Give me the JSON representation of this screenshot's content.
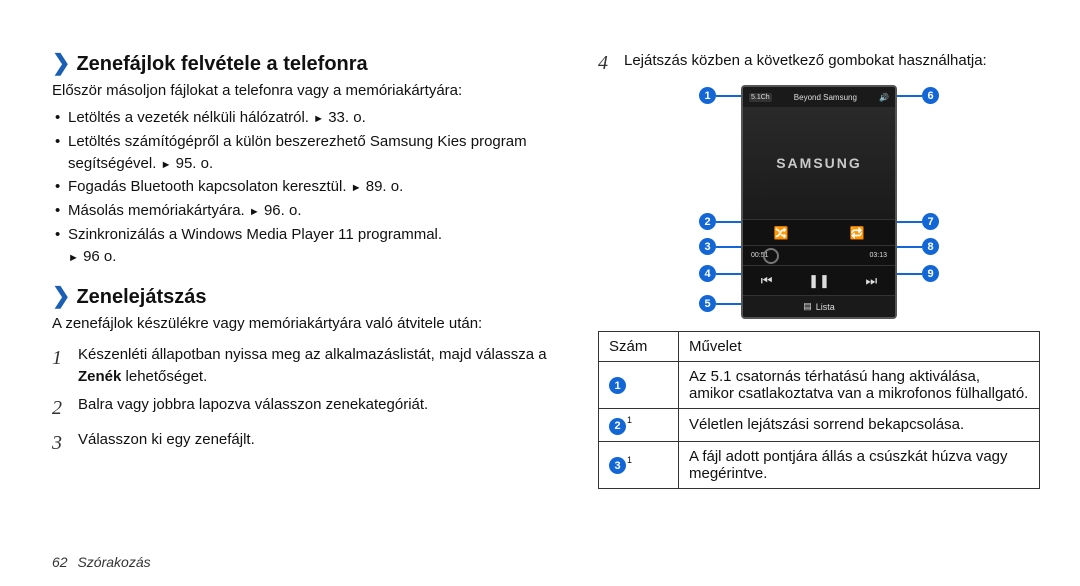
{
  "leftCol": {
    "heading1": "Zenefájlok felvétele a telefonra",
    "intro1": "Először másoljon fájlokat a telefonra vagy a memóriakártyára:",
    "bullets": [
      {
        "text": "Letöltés a vezeték nélküli hálózatról.",
        "ref": "33. o."
      },
      {
        "text": "Letöltés számítógépről a külön beszerezhető Samsung Kies program segítségével.",
        "ref": "95. o."
      },
      {
        "text": "Fogadás Bluetooth kapcsolaton keresztül.",
        "ref": "89. o."
      },
      {
        "text": "Másolás memóriakártyára.",
        "ref": "96. o."
      },
      {
        "text": "Szinkronizálás a Windows Media Player 11 programmal.",
        "ref": "96 o."
      }
    ],
    "heading2": "Zenelejátszás",
    "intro2": "A zenefájlok készülékre vagy memóriakártyára való átvitele után:",
    "steps": [
      {
        "n": "1",
        "pre": "Készenléti állapotban nyissa meg az alkalmazáslistát, majd válassza a ",
        "bold": "Zenék",
        "post": " lehetőséget."
      },
      {
        "n": "2",
        "pre": "Balra vagy jobbra lapozva válasszon zenekategóriát.",
        "bold": "",
        "post": ""
      },
      {
        "n": "3",
        "pre": "Válasszon ki egy zenefájlt.",
        "bold": "",
        "post": ""
      }
    ]
  },
  "rightCol": {
    "stepNum": "4",
    "stepText": "Lejátszás közben a következő gombokat használhatja:",
    "phone": {
      "chip": "5.1Ch",
      "title": "Beyond Samsung",
      "brand": "SAMSUNG",
      "t0": "00:51",
      "t1": "03:13",
      "lista": "Lista"
    },
    "callouts": {
      "left": [
        "1",
        "2",
        "3",
        "4",
        "5"
      ],
      "right": [
        "6",
        "7",
        "8",
        "9"
      ]
    },
    "table": {
      "h1": "Szám",
      "h2": "Művelet",
      "rows": [
        {
          "num": "1",
          "sup": "",
          "desc": "Az 5.1 csatornás térhatású hang aktiválása, amikor csatlakoztatva van a mikrofonos fülhallgató."
        },
        {
          "num": "2",
          "sup": "1",
          "desc": "Véletlen lejátszási sorrend bekapcsolása."
        },
        {
          "num": "3",
          "sup": "1",
          "desc": "A fájl adott pontjára állás a csúszkát húzva vagy megérintve."
        }
      ]
    }
  },
  "footer": {
    "page": "62",
    "section": "Szórakozás"
  }
}
